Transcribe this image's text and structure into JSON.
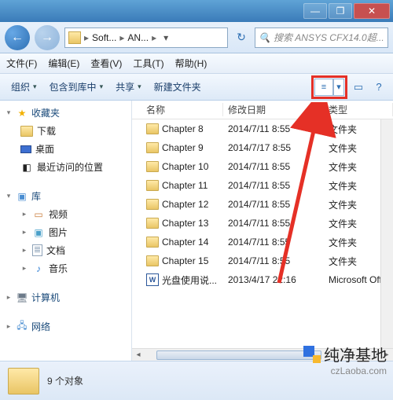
{
  "titlebar": {
    "min": "—",
    "max": "❐",
    "close": "✕"
  },
  "nav": {
    "back": "←",
    "fwd": "→"
  },
  "breadcrumb": {
    "seg1": "Soft...",
    "seg2": "AN...",
    "sep": "▸",
    "drop": "▾",
    "refresh": "↻"
  },
  "search": {
    "icon": "🔍",
    "placeholder": "搜索 ANSYS CFX14.0超..."
  },
  "menu": {
    "file": "文件(F)",
    "edit": "编辑(E)",
    "view": "查看(V)",
    "tools": "工具(T)",
    "help": "帮助(H)"
  },
  "toolbar": {
    "organize": "组织",
    "include": "包含到库中",
    "share": "共享",
    "newfolder": "新建文件夹",
    "view_icon": "≡",
    "view_drop": "▾",
    "preview": "▭",
    "help": "?"
  },
  "sidebar": {
    "fav_head": "收藏夹",
    "fav_items": [
      {
        "label": "下载",
        "icon": "↓"
      },
      {
        "label": "桌面",
        "icon": "■"
      },
      {
        "label": "最近访问的位置",
        "icon": "◧"
      }
    ],
    "lib_head": "库",
    "lib_items": [
      {
        "label": "视频",
        "icon": "▭"
      },
      {
        "label": "图片",
        "icon": "▣"
      },
      {
        "label": "文档",
        "icon": "📄"
      },
      {
        "label": "音乐",
        "icon": "♪"
      }
    ],
    "computer_head": "计算机",
    "network_head": "网络"
  },
  "columns": {
    "name": "名称",
    "date": "修改日期",
    "type": "类型"
  },
  "rows": [
    {
      "name": "Chapter 8",
      "date": "2014/7/11 8:55",
      "type": "文件夹",
      "kind": "folder"
    },
    {
      "name": "Chapter 9",
      "date": "2014/7/17 8:55",
      "type": "文件夹",
      "kind": "folder"
    },
    {
      "name": "Chapter 10",
      "date": "2014/7/11 8:55",
      "type": "文件夹",
      "kind": "folder"
    },
    {
      "name": "Chapter 11",
      "date": "2014/7/11 8:55",
      "type": "文件夹",
      "kind": "folder"
    },
    {
      "name": "Chapter 12",
      "date": "2014/7/11 8:55",
      "type": "文件夹",
      "kind": "folder"
    },
    {
      "name": "Chapter 13",
      "date": "2014/7/11 8:55",
      "type": "文件夹",
      "kind": "folder"
    },
    {
      "name": "Chapter 14",
      "date": "2014/7/11 8:55",
      "type": "文件夹",
      "kind": "folder"
    },
    {
      "name": "Chapter 15",
      "date": "2014/7/11 8:55",
      "type": "文件夹",
      "kind": "folder"
    },
    {
      "name": "光盘使用说...",
      "date": "2013/4/17 22:16",
      "type": "Microsoft Offi",
      "kind": "word"
    }
  ],
  "status": {
    "count": "9 个对象"
  },
  "watermark": {
    "main": "纯净基地",
    "sub": "czLaoba.com"
  }
}
